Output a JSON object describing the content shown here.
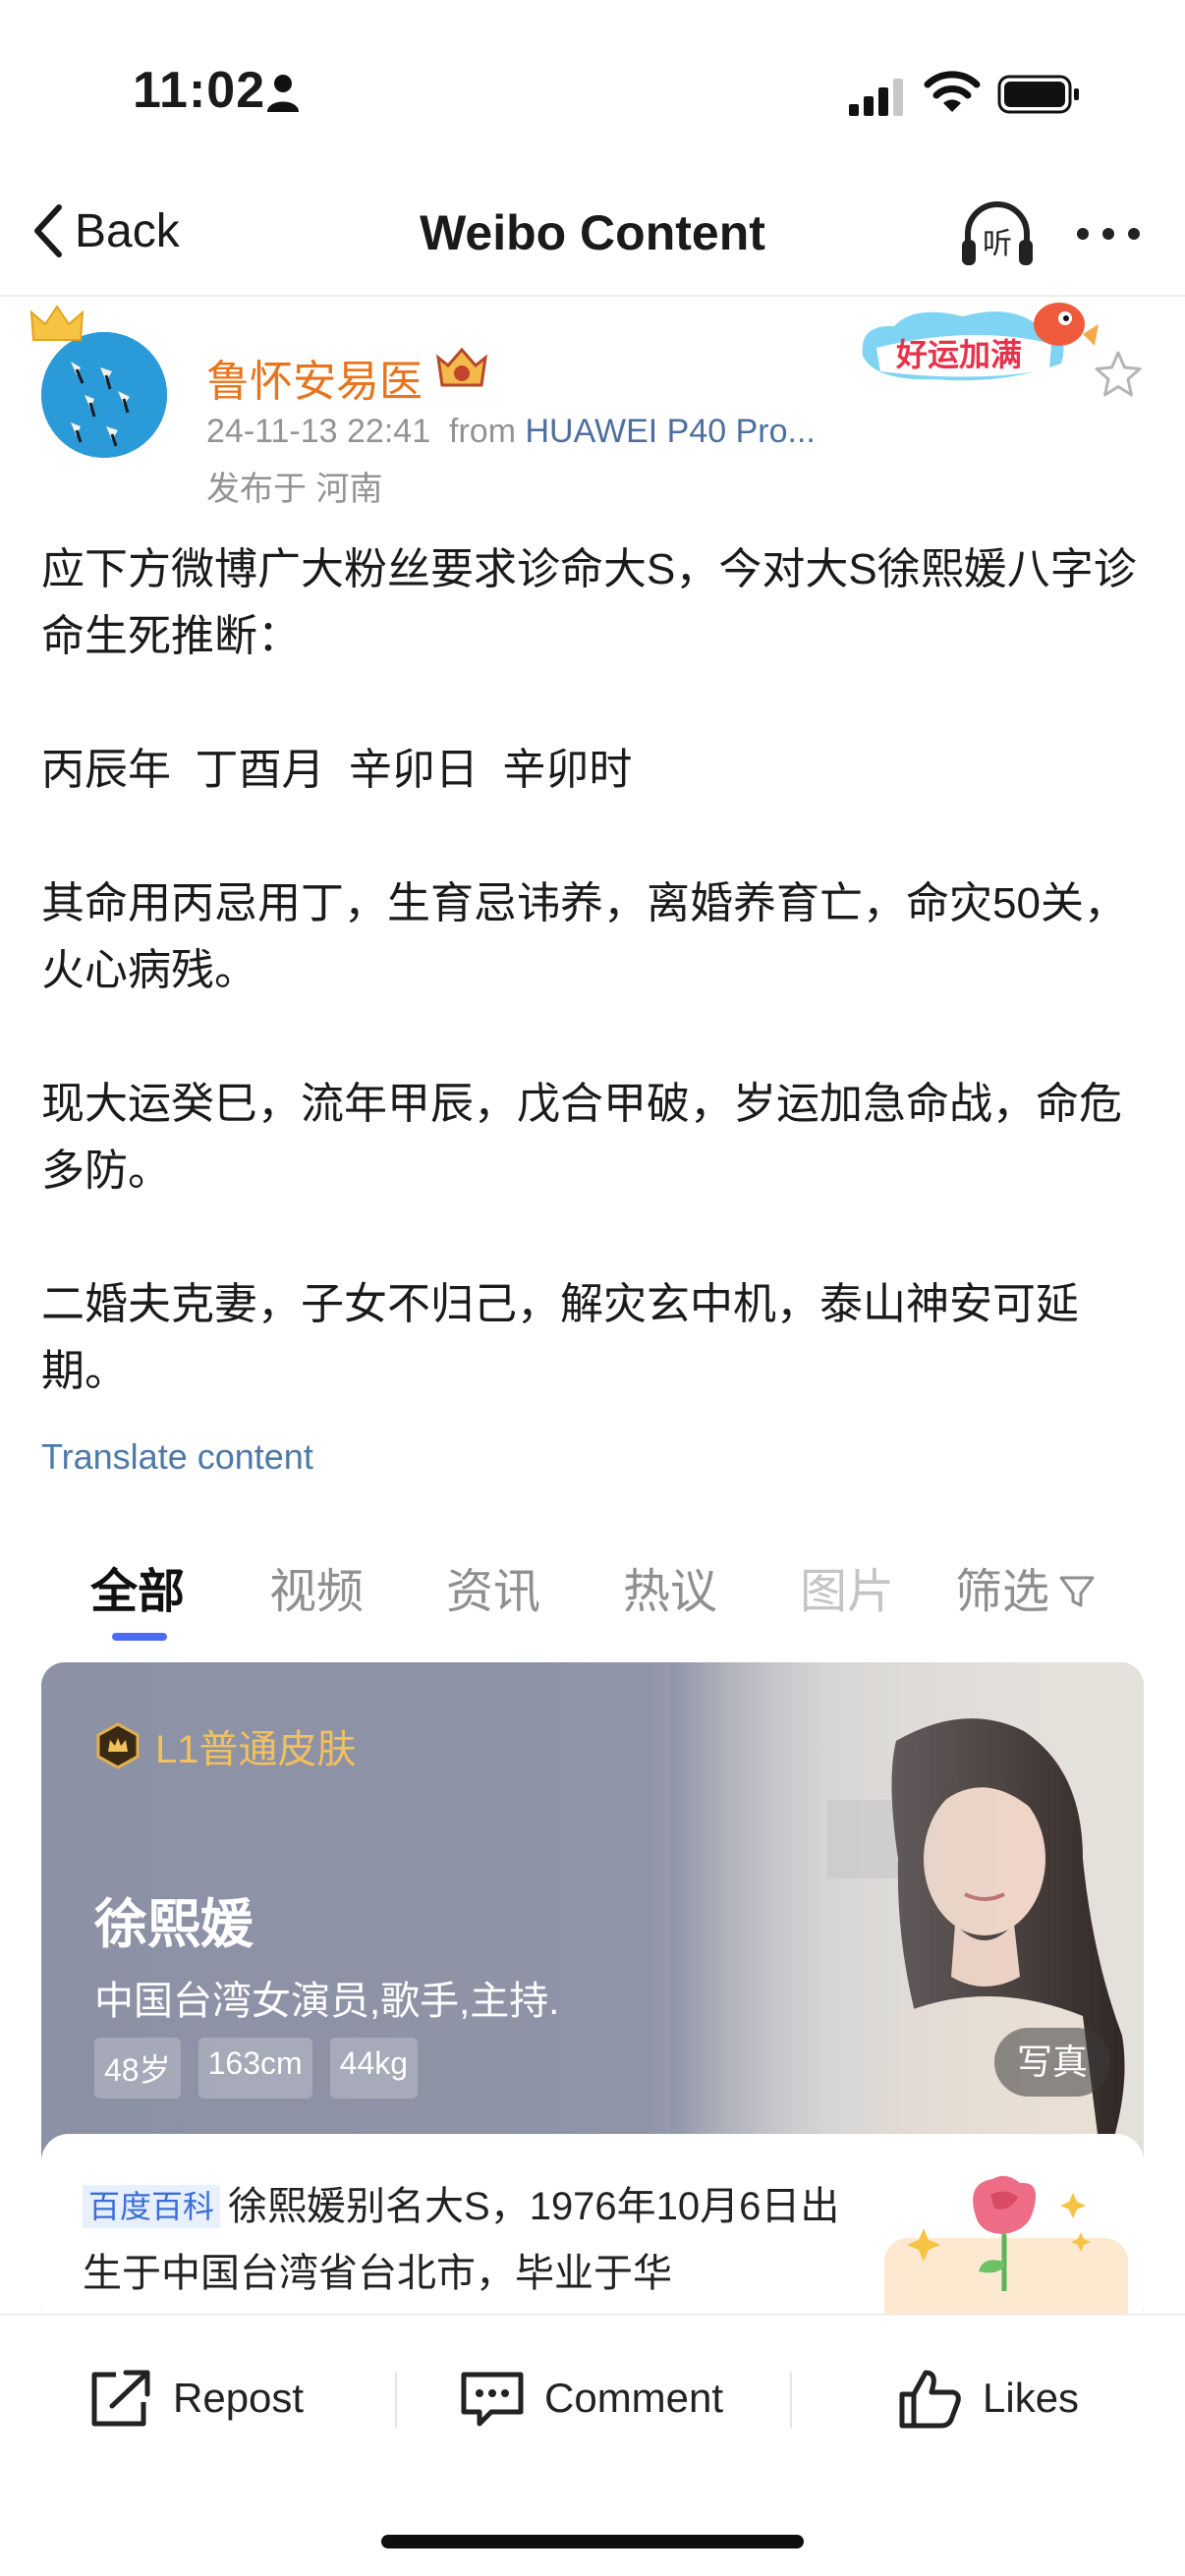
{
  "status_bar": {
    "time": "11:02"
  },
  "nav": {
    "back_label": "Back",
    "title": "Weibo Content",
    "listen_label": "听"
  },
  "post": {
    "author": "鲁怀安易医",
    "datetime": "24-11-13 22:41",
    "from_label": "from",
    "device": "HUAWEI P40 Pro...",
    "location": "发布于 河南",
    "luck_badge": "好运加满",
    "paragraphs": [
      "应下方微博广大粉丝要求诊命大S，今对大S徐熙媛八字诊命生死推断：",
      "丙辰年  丁酉月  辛卯日  辛卯时",
      "其命用丙忌用丁，生育忌讳养，离婚养育亡，命灾50关，火心病残。",
      "现大运癸巳，流年甲辰，戊合甲破，岁运加急命战，命危多防。",
      "二婚夫克妻，子女不归己，解灾玄中机，泰山神安可延期。"
    ],
    "translate_label": "Translate content"
  },
  "tabs": [
    "全部",
    "视频",
    "资讯",
    "热议",
    "图片",
    "筛选"
  ],
  "card": {
    "skin_label": "L1普通皮肤",
    "name": "徐熙媛",
    "description": "中国台湾女演员,歌手,主持.",
    "stats": [
      "48岁",
      "163cm",
      "44kg"
    ],
    "photo_tag": "写真",
    "baike_tag": "百度百科",
    "baike_text": "徐熙媛别名大S，1976年10月6日出生于中国台湾省台北市，毕业于华"
  },
  "actions": {
    "repost": "Repost",
    "comment": "Comment",
    "likes": "Likes"
  },
  "colors": {
    "author": "#e8741c",
    "link": "#4d78a8",
    "tab_indicator": "#4e6bf5",
    "skin_gold": "#f2c15e"
  }
}
